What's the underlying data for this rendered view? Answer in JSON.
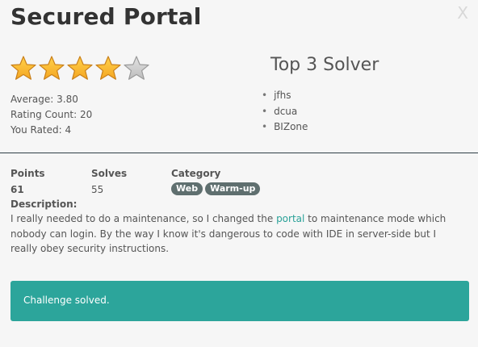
{
  "challenge": {
    "title": "Secured Portal",
    "close_label": "X"
  },
  "rating": {
    "value": 3.8,
    "max": 5,
    "average_text": "Average: 3.80",
    "count_text": "Rating Count: 20",
    "you_rated_text": "You Rated: 4",
    "star_color": "#f5a623",
    "empty_star_color": "#bdbdbd"
  },
  "top_solvers": {
    "title": "Top 3 Solver",
    "names": [
      "jfhs",
      "dcua",
      "BIZone"
    ]
  },
  "info": {
    "points_label": "Points",
    "points_value": "61",
    "solves_label": "Solves",
    "solves_value": "55",
    "category_label": "Category",
    "tags": [
      "Web",
      "Warm-up"
    ]
  },
  "description": {
    "label": "Description:",
    "text_before_link": "I really needed to do a maintenance, so I changed the ",
    "link_text": "portal",
    "text_after_link": " to maintenance mode which nobody can login. By the way I know it's dangerous to code with IDE in server-side but I really obey security instructions."
  },
  "status": {
    "message": "Challenge solved.",
    "color": "#2ca59b"
  }
}
